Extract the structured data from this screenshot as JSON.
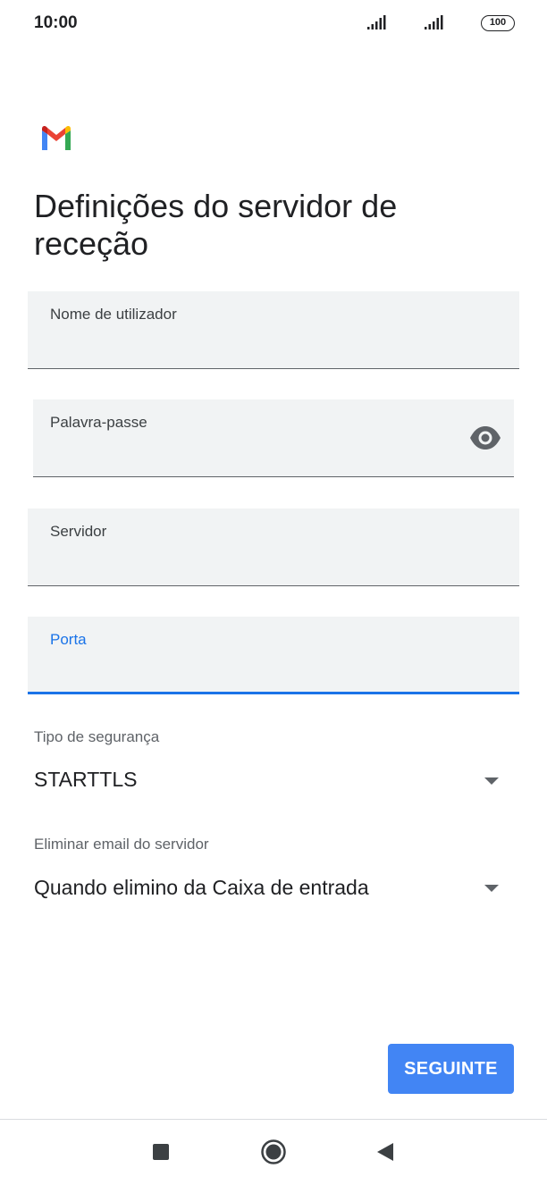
{
  "status_bar": {
    "time": "10:00",
    "battery": "100"
  },
  "page": {
    "title": "Definições do servidor de receção"
  },
  "form": {
    "username": {
      "label": "Nome de utilizador",
      "value": ""
    },
    "password": {
      "label": "Palavra-passe",
      "value": "",
      "toggle_icon": "eye-icon"
    },
    "server": {
      "label": "Servidor",
      "value": ""
    },
    "port": {
      "label": "Porta",
      "value": "",
      "focused": true
    },
    "security_type": {
      "label": "Tipo de segurança",
      "value": "STARTTLS"
    },
    "delete_email": {
      "label": "Eliminar email do servidor",
      "value": "Quando elimino da Caixa de entrada"
    }
  },
  "actions": {
    "next_label": "SEGUINTE"
  },
  "colors": {
    "accent": "#1a73e8",
    "button": "#4285f4",
    "field_bg": "#f1f3f4"
  },
  "nav_bar": {
    "icons": [
      "recents-square-icon",
      "home-circle-icon",
      "back-triangle-icon"
    ]
  }
}
